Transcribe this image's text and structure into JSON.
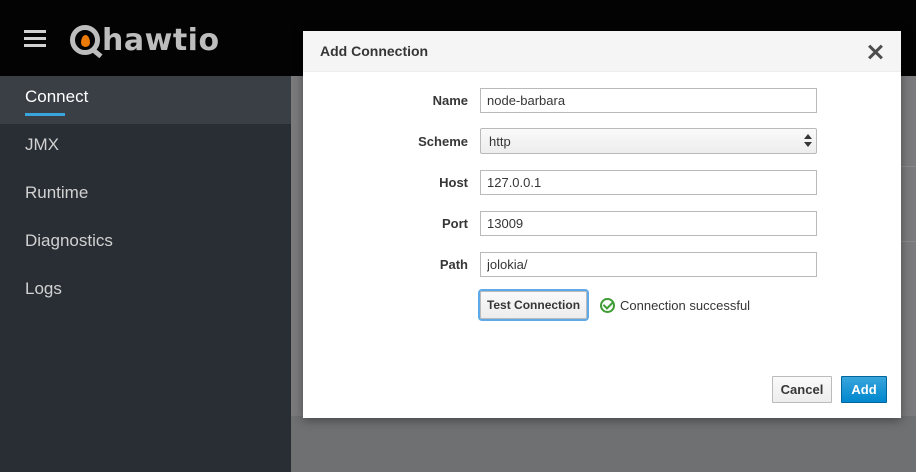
{
  "app": {
    "logo_text": "hawtio",
    "brand_colors": {
      "topbar": "#030303",
      "sidebar": "#292e34",
      "accent": "#39a5dc",
      "logo_flame": "#ec7a08"
    }
  },
  "sidebar": {
    "items": [
      {
        "label": "Connect",
        "active": true
      },
      {
        "label": "JMX",
        "active": false
      },
      {
        "label": "Runtime",
        "active": false
      },
      {
        "label": "Diagnostics",
        "active": false
      },
      {
        "label": "Logs",
        "active": false
      }
    ]
  },
  "modal": {
    "title": "Add Connection",
    "fields": {
      "name": {
        "label": "Name",
        "value": "node-barbara"
      },
      "scheme": {
        "label": "Scheme",
        "value": "http"
      },
      "host": {
        "label": "Host",
        "value": "127.0.0.1"
      },
      "port": {
        "label": "Port",
        "value": "13009"
      },
      "path": {
        "label": "Path",
        "value": "jolokia/"
      }
    },
    "test_button": "Test Connection",
    "status": {
      "text": "Connection successful",
      "color": "#3f9c35",
      "icon": "check-circle-icon"
    },
    "cancel_button": "Cancel",
    "add_button": "Add"
  }
}
